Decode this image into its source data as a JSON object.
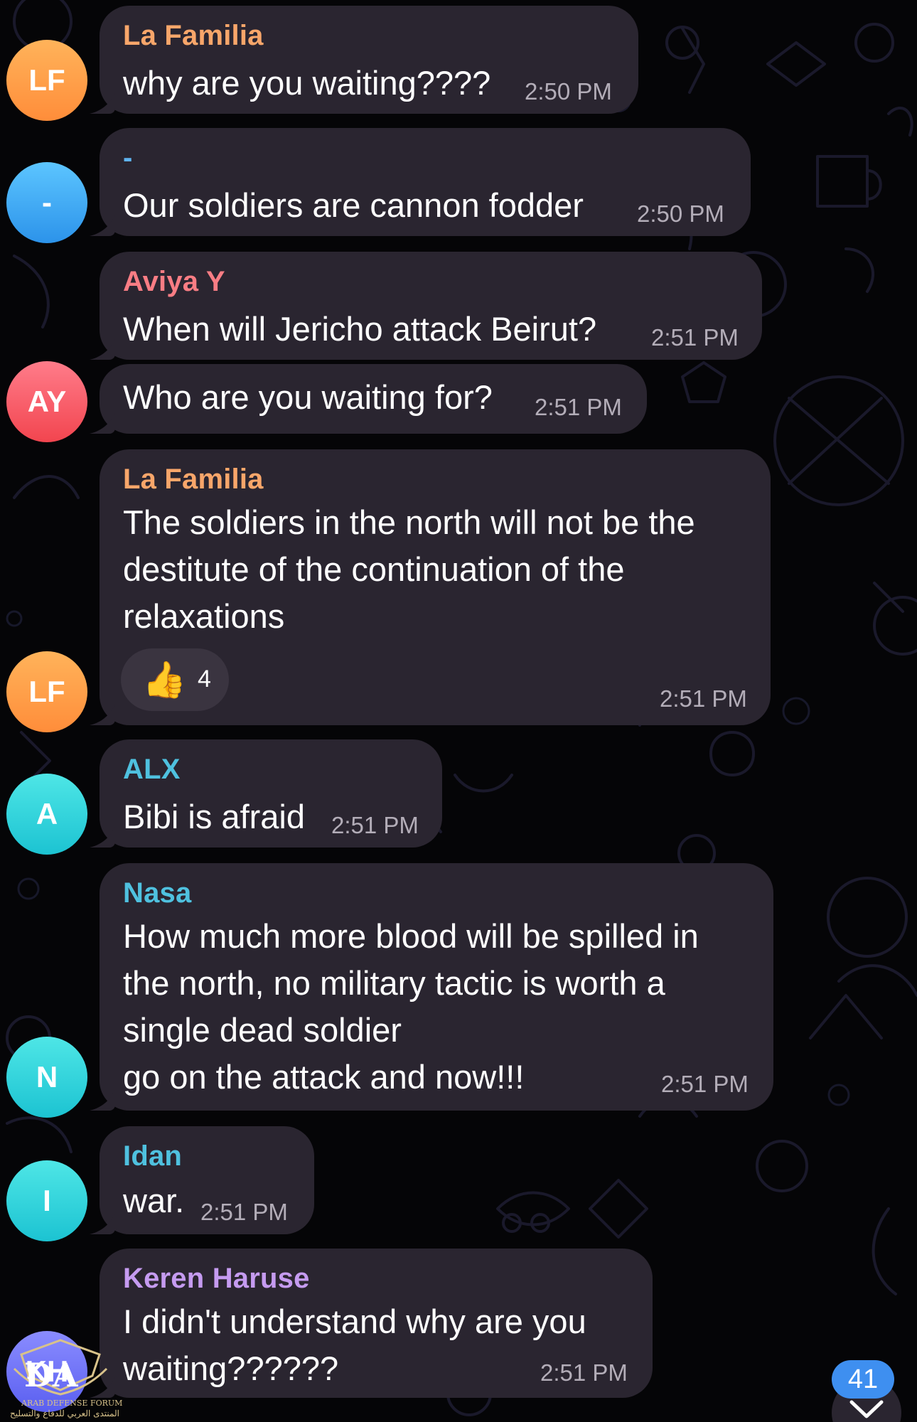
{
  "colors": {
    "bubble": "#2a2530",
    "time": "#b3adb8",
    "name_orange": "#f8a66a",
    "name_blue": "#5fb4f0",
    "name_red": "#f97d84",
    "name_cyan": "#4fc1df",
    "name_purple": "#c59bf0",
    "badge": "#3e8ff0"
  },
  "messages": [
    {
      "sender": "La Familia",
      "text": "why are you waiting????",
      "time": "2:50 PM"
    },
    {
      "sender": "-",
      "text": "Our soldiers are cannon fodder",
      "time": "2:50 PM"
    },
    {
      "sender": "Aviya Y",
      "text": "When will Jericho attack Beirut?",
      "time": "2:51 PM"
    },
    {
      "sender": "",
      "text": "Who are you waiting for?",
      "time": "2:51 PM"
    },
    {
      "sender": "La Familia",
      "text": "The soldiers in the north will not be the\ndestitute of the continuation of the\nrelaxations",
      "time": "2:51 PM",
      "reaction": {
        "emoji": "👍",
        "count": "4"
      }
    },
    {
      "sender": "ALX",
      "text": "Bibi is afraid",
      "time": "2:51 PM"
    },
    {
      "sender": "Nasa",
      "text": "How much more blood will be spilled in\nthe north, no military tactic is worth a\nsingle dead soldier\ngo on the attack and now!!!",
      "time": "2:51 PM"
    },
    {
      "sender": "Idan",
      "text": "war.",
      "time": "2:51 PM"
    },
    {
      "sender": "Keren Haruse",
      "text": "I didn't understand why are you\nwaiting??????",
      "time": "2:51 PM"
    }
  ],
  "avatars": {
    "la_familia_1": "LF",
    "dash": "-",
    "aviya": "AY",
    "la_familia_2": "LF",
    "alx": "A",
    "nasa": "N",
    "idan": "I",
    "keren": "KH"
  },
  "unread_count": "41",
  "scroll_icon": "chevron-down-icon",
  "watermark": {
    "letters": "DA",
    "title": "ARAB DEFENSE FORUM",
    "subtitle": "المنتدى العربي للدفاع والتسليح"
  }
}
